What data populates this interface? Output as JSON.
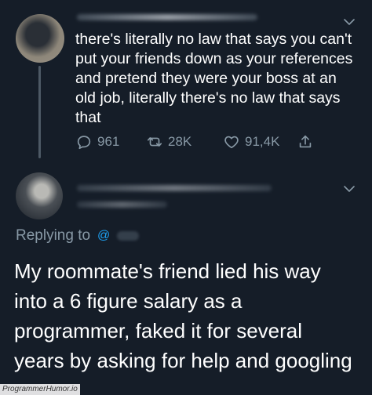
{
  "tweet": {
    "text": "there's literally no law that says you can't\nput your friends down as your references\nand pretend they were your boss at an\nold job, literally there's no law that says\nthat",
    "actions": {
      "reply_count": "961",
      "retweet_count": "28K",
      "like_count": "91,4K"
    }
  },
  "reply": {
    "replying_to_label": "Replying to",
    "text": "My roommate's friend lied his way\ninto a 6 figure salary as a\nprogrammer, faked it for several\nyears by asking for help and googling"
  },
  "watermark": "ProgrammerHumor.io",
  "colors": {
    "background": "#151d28",
    "secondary_text": "#8899a6",
    "accent": "#1da1f2"
  },
  "icons": {
    "reply": "reply-icon",
    "retweet": "retweet-icon",
    "like": "heart-icon",
    "share": "share-icon",
    "more": "chevron-down-icon",
    "mention": "at-icon"
  }
}
